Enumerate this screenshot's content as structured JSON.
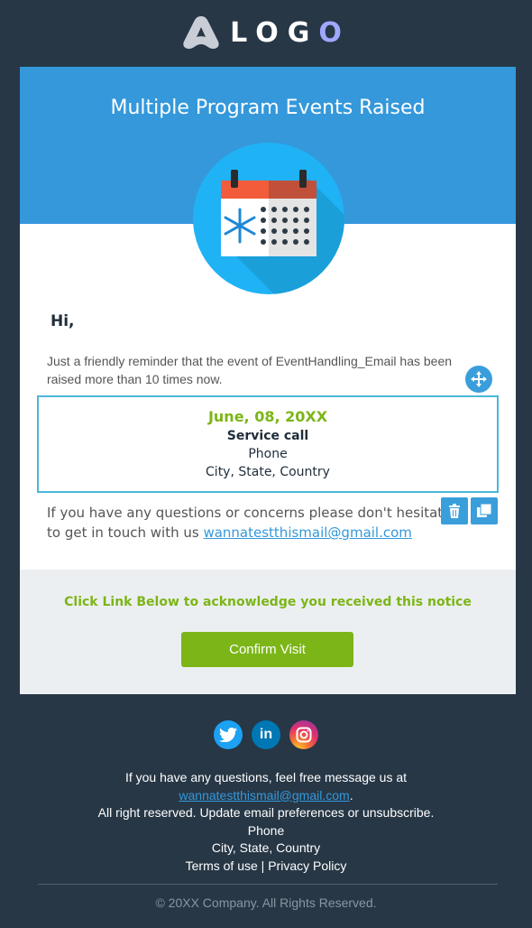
{
  "brand": {
    "logo_text_a": "L",
    "logo_text_b": "O",
    "logo_text_c": "G",
    "logo_text_d": "O"
  },
  "hero": {
    "title": "Multiple Program Events Raised"
  },
  "message": {
    "greeting": "Hi,",
    "intro": "Just a friendly reminder that the event of EventHandling_Email has been raised more than 10 times now."
  },
  "event": {
    "date": "June, 08, 20XX",
    "title": "Service call",
    "phone": "Phone",
    "location": "City, State, Country"
  },
  "contact": {
    "text": "If you have any questions or concerns please don't hesitate to get in touch with us",
    "email": "wannatestthismail@gmail.com"
  },
  "cta": {
    "text": "Click Link Below to acknowledge you received this notice",
    "button_label": "Confirm Visit"
  },
  "social": {
    "twitter_icon": "twitter-icon",
    "linkedin_icon": "linkedin-icon",
    "instagram_icon": "instagram-icon"
  },
  "footer": {
    "line1": "If you have any questions, feel free message us at",
    "email": "wannatestthismail@gmail.com",
    "email_suffix": ".",
    "line3": "All right reserved. Update email preferences or unsubscribe.",
    "phone": "Phone",
    "location": "City, State, Country",
    "terms": "Terms of use",
    "separator": " | ",
    "privacy": "Privacy Policy",
    "copyright": "© 20XX Company. All Rights Reserved."
  },
  "colors": {
    "background": "#273746",
    "hero": "#3498db",
    "accent_green": "#7cb518",
    "link": "#3498db"
  }
}
